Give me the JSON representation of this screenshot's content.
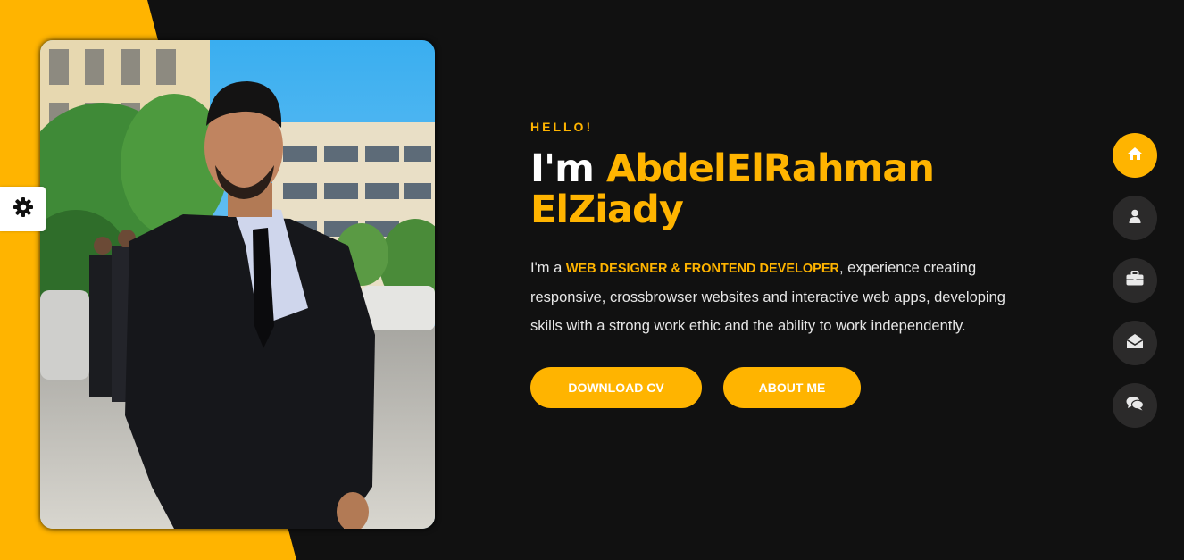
{
  "hero": {
    "greeting": "HELLO!",
    "title_prefix": "I'm ",
    "name": "AbdelElRahman ElZiady",
    "intro_prefix": "I'm a ",
    "role": "WEB DESIGNER & FRONTEND DEVELOPER",
    "intro_suffix": ", experience creating responsive, crossbrowser websites and interactive web apps, developing skills with a strong work ethic and the ability to work independently.",
    "download_cv_label": "DOWNLOAD CV",
    "about_me_label": "ABOUT ME"
  },
  "side_nav": {
    "items": [
      {
        "icon": "home-icon",
        "active": true
      },
      {
        "icon": "user-icon",
        "active": false
      },
      {
        "icon": "briefcase-icon",
        "active": false
      },
      {
        "icon": "envelope-open-icon",
        "active": false
      },
      {
        "icon": "comments-icon",
        "active": false
      }
    ]
  },
  "settings": {
    "icon": "gear-icon"
  },
  "colors": {
    "accent": "#ffb400",
    "background": "#111111",
    "nav_button": "#2b2a2a",
    "text": "#ffffff"
  }
}
